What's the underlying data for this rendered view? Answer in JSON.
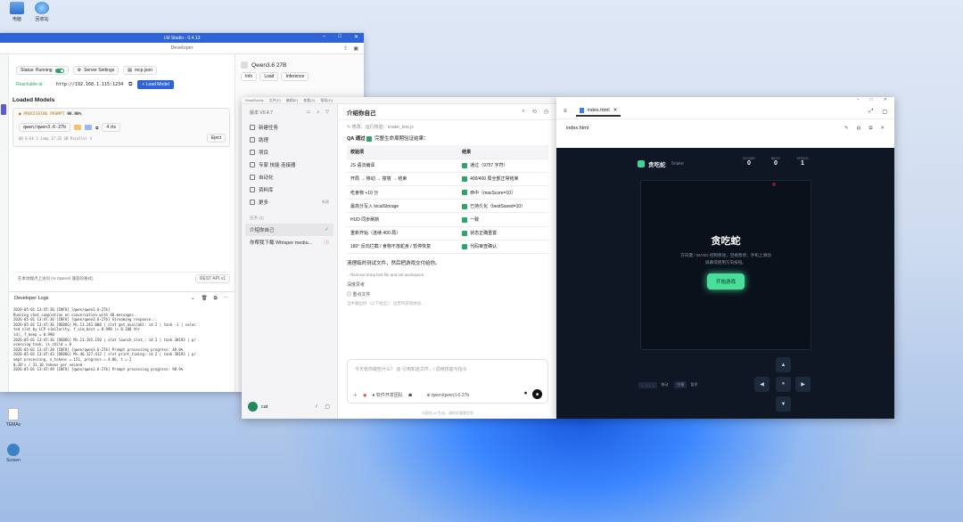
{
  "desktop": {
    "icons": [
      {
        "label": "电脑"
      },
      {
        "label": "回收站"
      },
      {
        "label": "TEMAs"
      },
      {
        "label": "Screen"
      }
    ],
    "lm_sidebar_sticker": "LM Studio"
  },
  "lm": {
    "title": "LM Studio - 0.4.13",
    "subtitle": "Developer",
    "status_label": "Status: Running",
    "server_settings": "Server Settings",
    "mcp": "mcp.json",
    "reachable_label": "Reachable at:",
    "url": "http://192.168.1.115:1234",
    "load_model": "+ Load Model",
    "loaded_models_title": "Loaded Models",
    "model_state": "● PROCESSING PROMPT",
    "model_progress": "98.90%",
    "model_id": "qwen/qwen3.6-27b",
    "model_ctx": "4 ctx",
    "model_meta": "QB 8.6k   1 Jump 17.32 GB   Parallel 4",
    "eject": "Eject",
    "api_note": "在本地端点上访问 (% OpenAI 兼容的格式)",
    "rest_api": "REST API v1",
    "dev_logs_title": "Developer Logs",
    "logs": [
      "2026-05-01 13:47:36 [INFO] [qwen/qwen3.6-27b]",
      "                          Running chat completion on conversation with 48 messages.",
      "2026-05-01 13:47:36 [INFO] [qwen/qwen3.6-27b] Streaming response...",
      "2026-05-01 13:47:36 [DEBUG] Ms.13.241.000 | slot get_availabl: id 2 | task -1 | selec",
      "                          ted slot by LCP similarity, f_sim_best = 0.990 (> 0.100 thr",
      "                          ld), f_keep = 0.990",
      "2026-05-01 13:47:36 [DEBUG] Ms.21.192.150 | slot launch_slot_: id 2 | task 38193 | pr",
      "                          ocessing task, is_child = 0",
      "2026-05-01 13:47:38 [INFO] [qwen/qwen3.6-27b] Prompt processing progress: 48.0%",
      "2026-05-01 13:47:43 [DEBUG] Ms.46.127.412 | slot print_timing: id 2 | task 38193 | pr",
      "                          ompt processing, n_tokens =    151, progress = 4.06, t =  2",
      "                          0.20's / 31.10 tokens per second",
      "2026-05-01 13:47:49 [INFO] [qwen/qwen3.6-27b] Prompt processing progress: 98.9%"
    ],
    "right": {
      "model": "Qwen3.6 27B",
      "tabs": [
        "Info",
        "Load",
        "Inference"
      ]
    }
  },
  "wb": {
    "app": "WorkBuddy",
    "menus": [
      "文件(F)",
      "编辑(E)",
      "查看(V)",
      "帮助(H)"
    ],
    "version": "版本 V0.4.7",
    "nav": [
      "新建任务",
      "助理",
      "项目",
      "专家 技能 连接器",
      "自动化",
      "资料库",
      "更多"
    ],
    "more_badge": "新建",
    "tasks_label": "任务 (2)",
    "tasks": [
      "介绍你自己",
      "你帮我下载 Whisper mediu..."
    ],
    "user": "cat",
    "chat_title": "介绍你自己",
    "edited_note": "修改、运行校验：snake_test.js",
    "qa_title": "QA 通过",
    "qa_subtitle": "完整生命周期验证结果：",
    "table_headers": [
      "校验项",
      "结果"
    ],
    "rows": [
      [
        "JS 语法编译",
        "通过（9757 字符）"
      ],
      [
        "开局 → 移动 → 撞墙 → 结束",
        "400/400 局全部正常结束"
      ],
      [
        "吃食物 +10 分",
        "命中（maxScore=10）"
      ],
      [
        "最高分写入 localStorage",
        "已持久化（bestSaved=10）"
      ],
      [
        "HUD 同步刷新",
        "一致"
      ],
      [
        "重新开始（连续 400 局）",
        "状态正确重置"
      ],
      [
        "180° 反向拦截 / 食物不落蛇身 / 暂停恢复",
        "代码审查确认"
      ]
    ],
    "after_table": "清理临时测试文件，然后把游戏交付给你。",
    "step_remove": "Remove temp test file and set workspace",
    "thinking": "深度思考",
    "todo": "重点文件",
    "hint": "当中输出时（以下给出）：运营时游戏体验…",
    "input_placeholder": "今天有你做些什么？ @ 引用知道文件，/ 调用技能与指令",
    "toolbar_btns": [
      "软件开发团队",
      "qwen/qwen3.6-27b"
    ],
    "footer": "内容由 AI 生成，请核实重要信息"
  },
  "pv": {
    "tab": "index.html",
    "path": "index.html",
    "game": {
      "logo": "贪吃蛇",
      "logo_sub": "Snake",
      "score_label": "SCORE",
      "score": "0",
      "best_label": "BEST",
      "best": "0",
      "speed_label": "SPEED",
      "speed": "1",
      "title": "贪吃蛇",
      "desc1": "方向键 / WASD 控制移动，空格暂停，手机上滑动",
      "desc2": "屏幕或使用方向按钮。",
      "start": "开始游戏",
      "hint_keys": "← ↑ ↓ →",
      "hint_move": "移动",
      "hint_space": "空格",
      "hint_pause": "暂停",
      "up": "▲",
      "left": "◀",
      "pause": "⏸",
      "right": "▶",
      "down": "▼"
    }
  }
}
